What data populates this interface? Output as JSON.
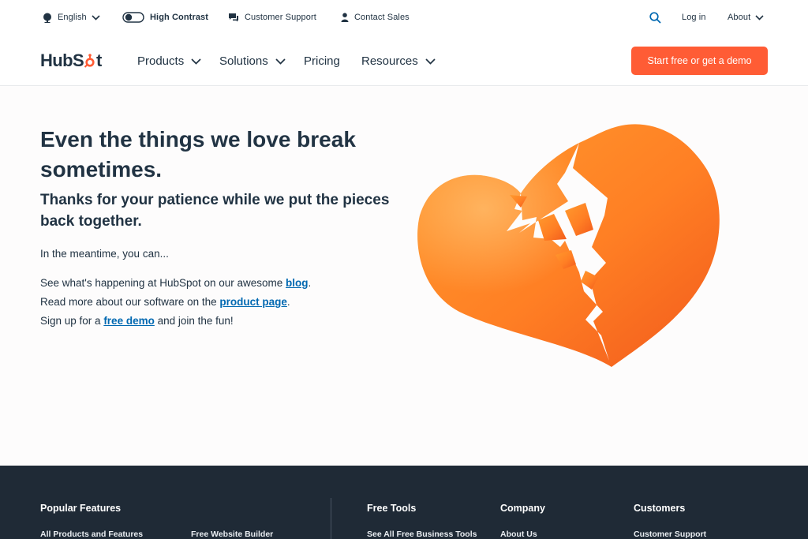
{
  "utility": {
    "language": "English",
    "contrast": "High Contrast",
    "support": "Customer Support",
    "sales": "Contact Sales",
    "login": "Log in",
    "about": "About"
  },
  "nav": {
    "logo": "HubSpot",
    "items": [
      "Products",
      "Solutions",
      "Pricing",
      "Resources"
    ],
    "cta": "Start free or get a demo"
  },
  "hero": {
    "title": "Even the things we love break sometimes.",
    "subtitle": "Thanks for your patience while we put the pieces back together.",
    "intro": "In the meantime, you can...",
    "line1_pre": "See what's happening at HubSpot on our awesome ",
    "line1_link": "blog",
    "line1_post": ".",
    "line2_pre": "Read more about our software on the ",
    "line2_link": "product page",
    "line2_post": ".",
    "line3_pre": "Sign up for a ",
    "line3_link": "free demo",
    "line3_post": " and join the fun!"
  },
  "footer": {
    "headings": [
      "Popular Features",
      "Free Tools",
      "Company",
      "Customers"
    ],
    "links": [
      "All Products and Features",
      "Free Website Builder",
      "See All Free Business Tools",
      "About Us",
      "Customer Support"
    ]
  },
  "colors": {
    "brand_orange": "#ff5c35",
    "link_blue": "#0068b1",
    "text_dark": "#213343",
    "footer_bg": "#1f2a36"
  },
  "icons": {
    "language": "globe-icon",
    "contrast": "toggle-icon",
    "support": "chat-bubble-icon",
    "sales": "person-icon",
    "search": "search-icon",
    "dropdown": "chevron-down-icon",
    "illustration": "broken-heart-icon"
  }
}
